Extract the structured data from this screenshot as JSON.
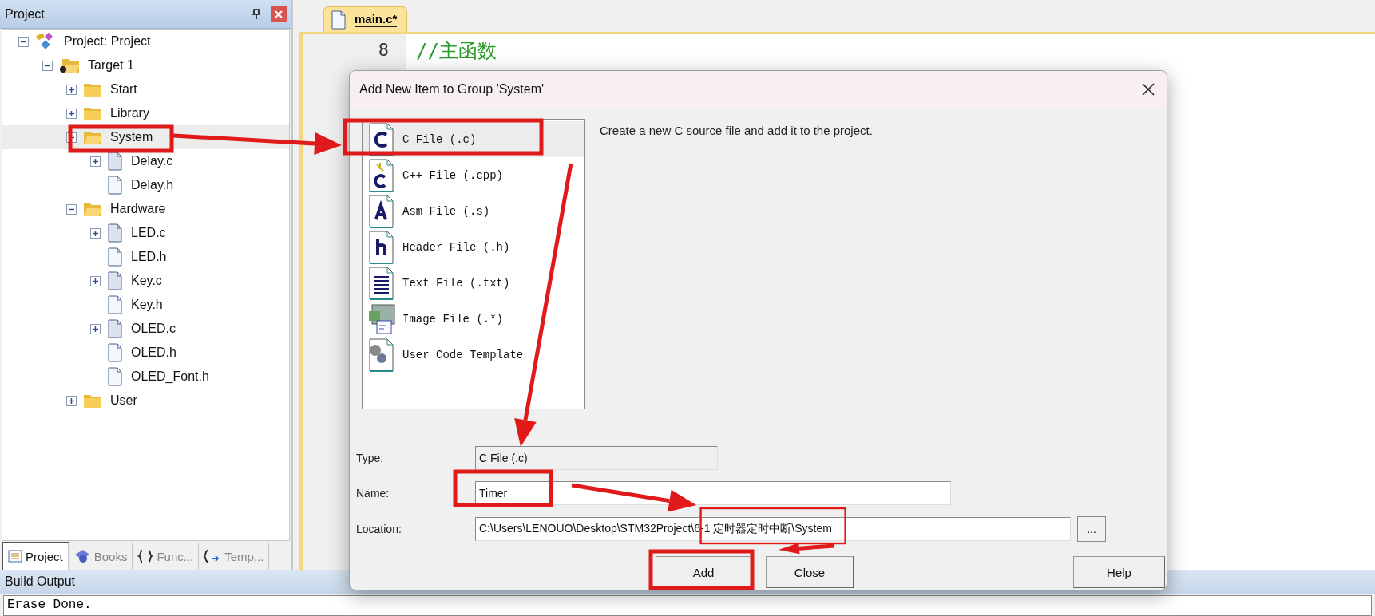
{
  "project_panel": {
    "title": "Project",
    "tree": [
      {
        "label": "Project: Project",
        "kind": "project",
        "expanded": true,
        "selected": false,
        "children": [
          {
            "label": "Target 1",
            "kind": "target",
            "expanded": true,
            "selected": false,
            "children": [
              {
                "label": "Start",
                "kind": "folder",
                "expanded": false,
                "selected": false
              },
              {
                "label": "Library",
                "kind": "folder",
                "expanded": false,
                "selected": false
              },
              {
                "label": "System",
                "kind": "folder",
                "expanded": true,
                "selected": true,
                "children": [
                  {
                    "label": "Delay.c",
                    "kind": "file",
                    "expanded": false,
                    "selected": false
                  },
                  {
                    "label": "Delay.h",
                    "kind": "file",
                    "selected": false
                  }
                ]
              },
              {
                "label": "Hardware",
                "kind": "folder",
                "expanded": true,
                "selected": false,
                "children": [
                  {
                    "label": "LED.c",
                    "kind": "file",
                    "expanded": false,
                    "selected": false
                  },
                  {
                    "label": "LED.h",
                    "kind": "file",
                    "selected": false
                  },
                  {
                    "label": "Key.c",
                    "kind": "file",
                    "expanded": false,
                    "selected": false
                  },
                  {
                    "label": "Key.h",
                    "kind": "file",
                    "selected": false
                  },
                  {
                    "label": "OLED.c",
                    "kind": "file",
                    "expanded": false,
                    "selected": false
                  },
                  {
                    "label": "OLED.h",
                    "kind": "file",
                    "selected": false
                  },
                  {
                    "label": "OLED_Font.h",
                    "kind": "file",
                    "selected": false
                  }
                ]
              },
              {
                "label": "User",
                "kind": "folder",
                "expanded": false,
                "selected": false
              }
            ]
          }
        ]
      }
    ],
    "tabs": [
      {
        "label": "Project",
        "kind": "project",
        "selected": true
      },
      {
        "label": "Books",
        "kind": "books",
        "selected": false
      },
      {
        "label": "Func...",
        "kind": "functions",
        "selected": false
      },
      {
        "label": "Temp...",
        "kind": "templates",
        "selected": false
      }
    ]
  },
  "editor": {
    "tabs": [
      {
        "label": "main.c*",
        "selected": true
      }
    ],
    "lines": [
      {
        "number": "8",
        "code": "//主函数"
      }
    ]
  },
  "build_output": {
    "title": "Build Output",
    "text": "Erase Done."
  },
  "dialog": {
    "title": "Add New Item to Group 'System'",
    "items": [
      {
        "label": "C File (.c)",
        "kind": "c",
        "selected": true
      },
      {
        "label": "C++ File (.cpp)",
        "kind": "cpp",
        "selected": false
      },
      {
        "label": "Asm File (.s)",
        "kind": "asm",
        "selected": false
      },
      {
        "label": "Header File (.h)",
        "kind": "header",
        "selected": false
      },
      {
        "label": "Text File (.txt)",
        "kind": "text",
        "selected": false
      },
      {
        "label": "Image File (.*)",
        "kind": "image",
        "selected": false
      },
      {
        "label": "User Code Template",
        "kind": "template",
        "selected": false
      }
    ],
    "description": "Create a new C source file and add it to the project.",
    "type": {
      "label": "Type:",
      "value": "C File (.c)"
    },
    "name": {
      "label": "Name:",
      "value": "Timer"
    },
    "location": {
      "label": "Location:",
      "value": "C:\\Users\\LENOUO\\Desktop\\STM32Project\\6-1 定时器定时中断\\System"
    },
    "browse_button": "...",
    "buttons": [
      {
        "label": "Add"
      },
      {
        "label": "Close"
      },
      {
        "label": "Help"
      }
    ]
  }
}
